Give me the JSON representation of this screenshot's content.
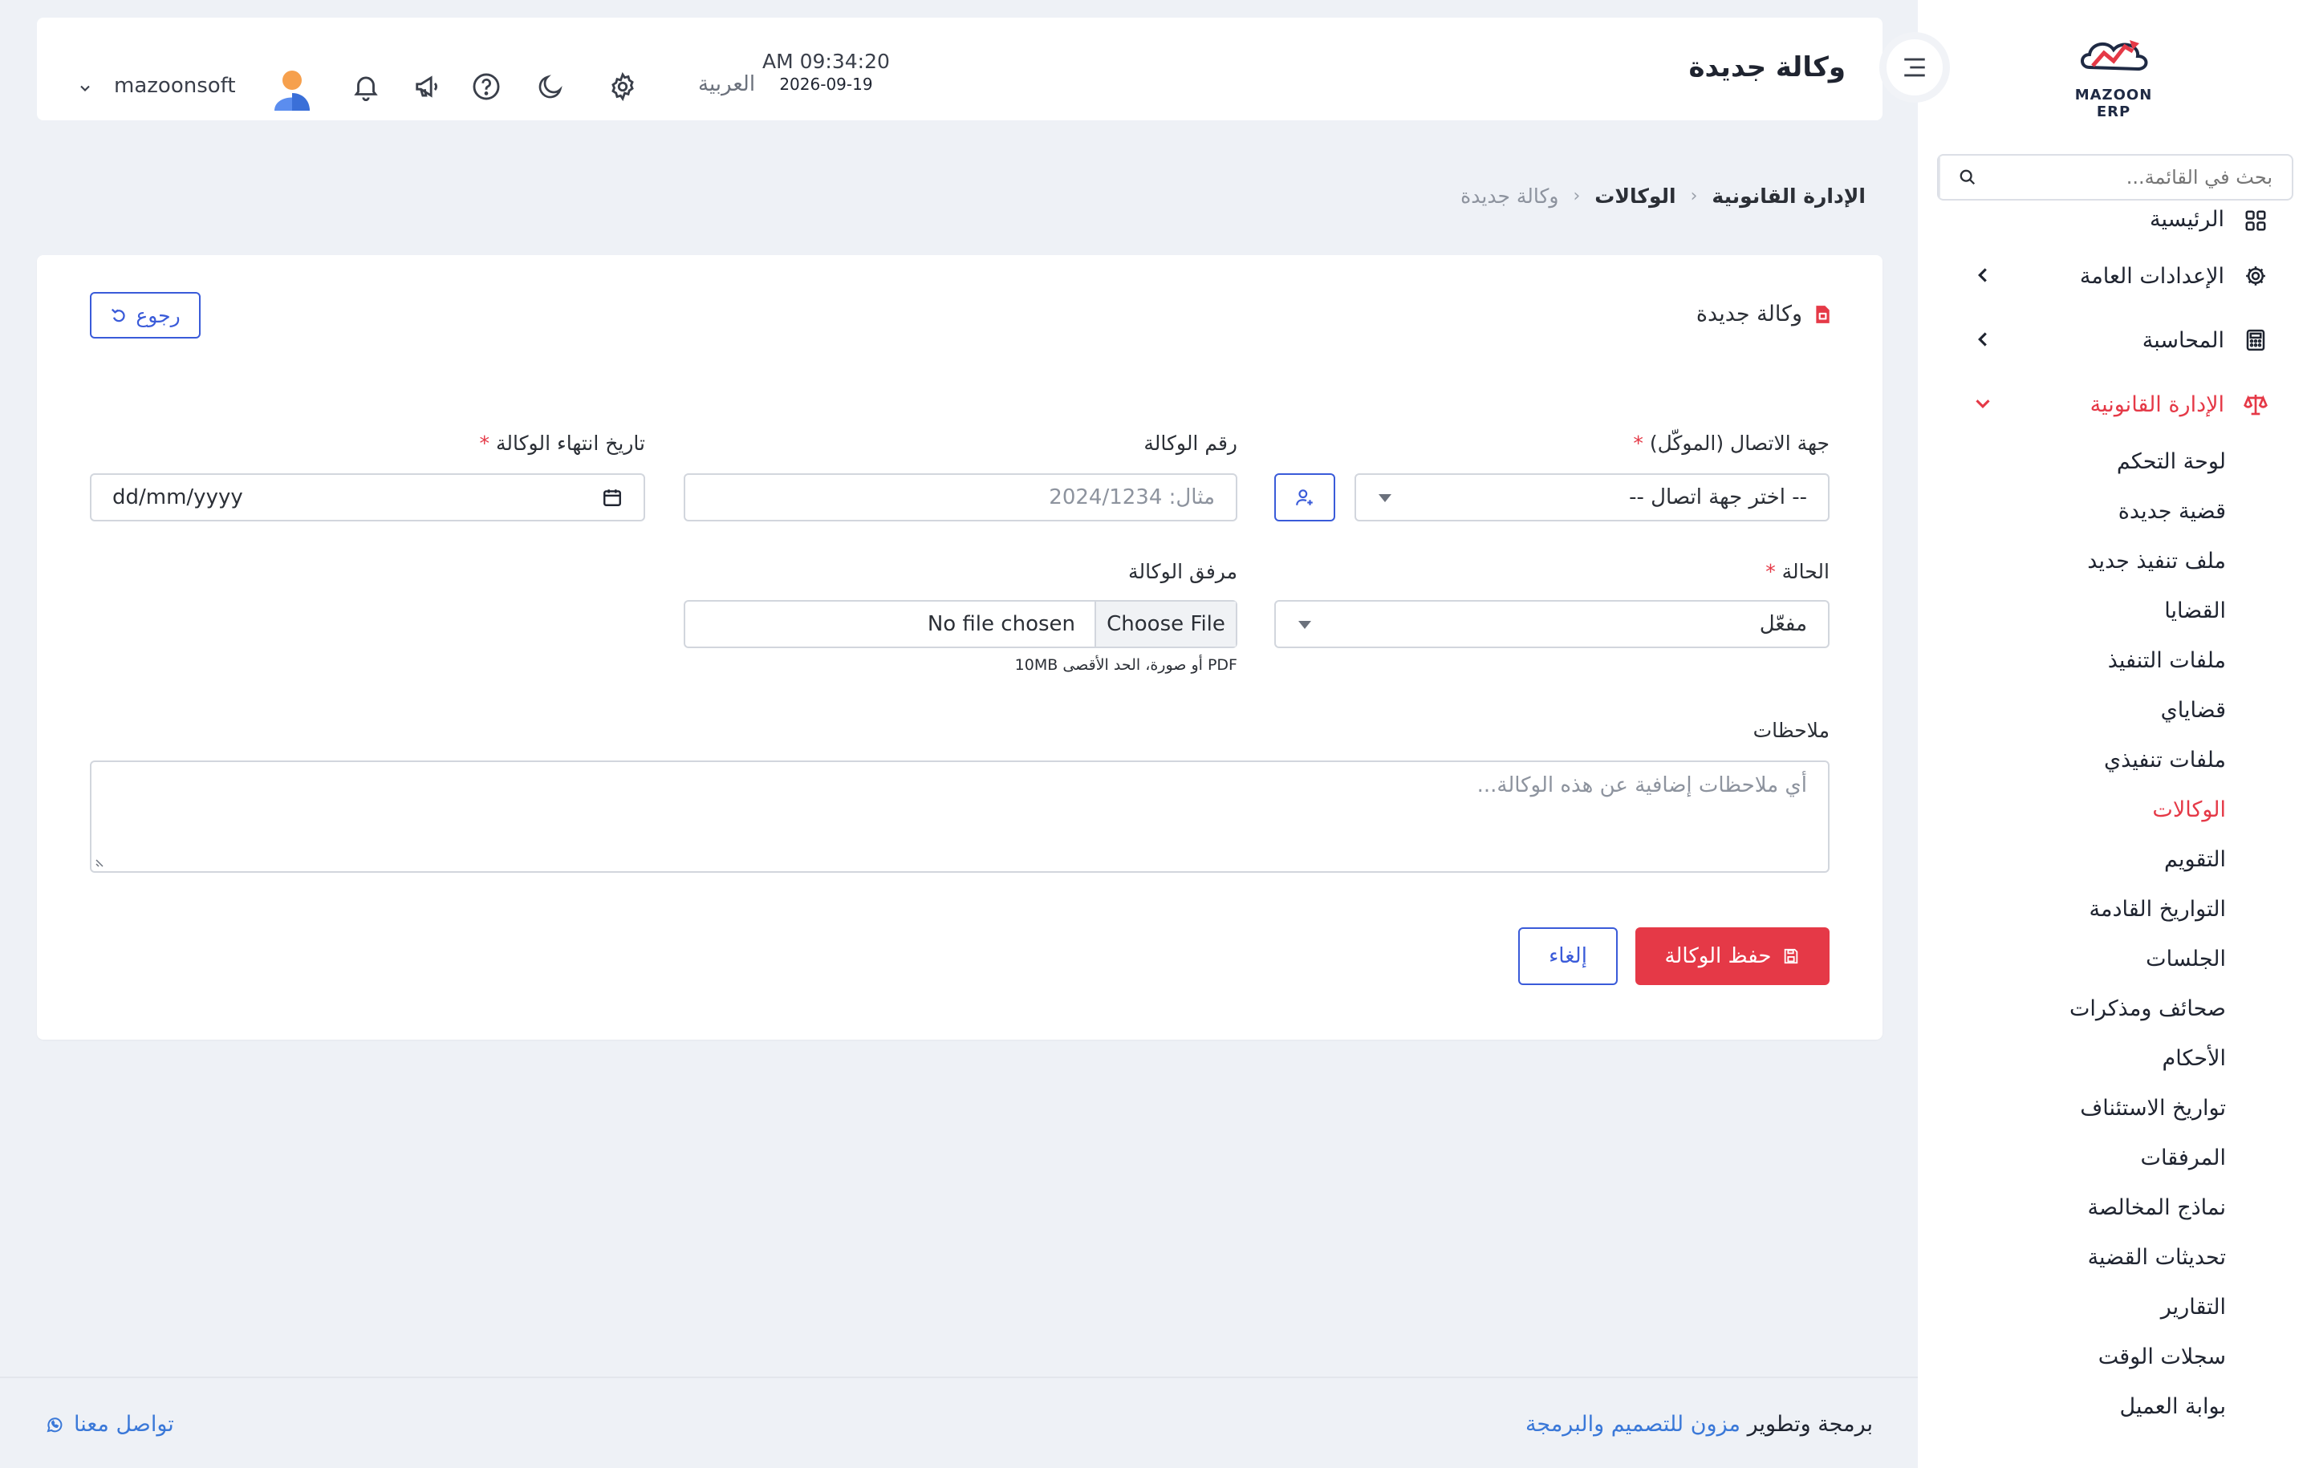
{
  "colors": {
    "accent": "#e53947",
    "primary": "#3a5bd9",
    "link": "#3a78d8",
    "background": "#eef1f6"
  },
  "sidebar": {
    "logo_text": "MAZOON ERP",
    "search_placeholder": "بحث في القائمة...",
    "items": [
      {
        "label": "الرئيسية",
        "icon": "grid-icon"
      },
      {
        "label": "الإعدادات العامة",
        "icon": "gear-icon"
      },
      {
        "label": "المحاسبة",
        "icon": "calculator-icon"
      },
      {
        "label": "الإدارة القانونية",
        "icon": "scale-icon"
      }
    ],
    "sub_items": [
      "لوحة التحكم",
      "قضية جديدة",
      "ملف تنفيذ جديد",
      "القضايا",
      "ملفات التنفيذ",
      "قضاياي",
      "ملفات تنفيذي",
      "الوكالات",
      "التقويم",
      "التواريخ القادمة",
      "الجلسات",
      "صحائف ومذكرات",
      "الأحكام",
      "تواريخ الاستئناف",
      "المرفقات",
      "نماذج المخالصة",
      "تحديثات القضية",
      "التقارير",
      "سجلات الوقت",
      "بوابة العميل"
    ]
  },
  "header": {
    "title": "وكالة جديدة",
    "time": "AM 09:34:20",
    "date": "2026-09-19",
    "language": "العربية",
    "username": "mazoonsoft"
  },
  "breadcrumb": {
    "root": "الإدارة القانونية",
    "section": "الوكالات",
    "current": "وكالة جديدة"
  },
  "form": {
    "title": "وكالة جديدة",
    "back_label": "رجوع",
    "contact_label": "جهة الاتصال (الموكّل)",
    "contact_placeholder": "-- اختر جهة اتصال --",
    "number_label": "رقم الوكالة",
    "number_placeholder": "مثال: 2024/1234",
    "expiry_label": "تاريخ انتهاء الوكالة",
    "expiry_placeholder": "dd/mm/yyyy",
    "status_label": "الحالة",
    "status_value": "مفعّل",
    "attachment_label": "مرفق الوكالة",
    "file_button": "Choose File",
    "file_none": "No file chosen",
    "attachment_hint": "PDF أو صورة، الحد الأقصى 10MB",
    "notes_label": "ملاحظات",
    "notes_placeholder": "أي ملاحظات إضافية عن هذه الوكالة...",
    "save_label": "حفظ الوكالة",
    "cancel_label": "إلغاء",
    "required_mark": "*"
  },
  "footer": {
    "credit_prefix": "برمجة وتطوير",
    "credit_link": "مزون للتصميم والبرمجة",
    "contact": "تواصل معنا"
  }
}
